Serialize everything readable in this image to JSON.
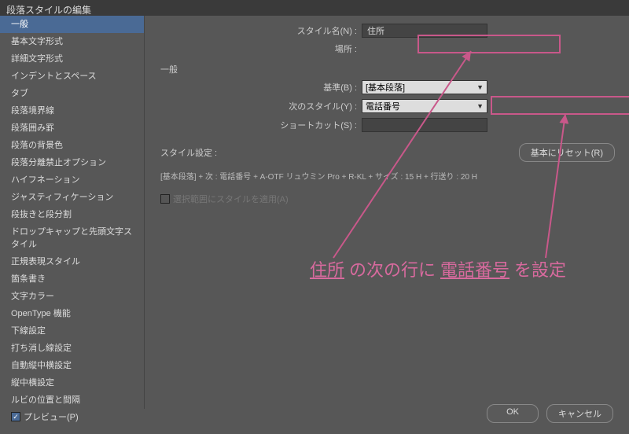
{
  "title": "段落スタイルの編集",
  "sidebar": {
    "items": [
      "一般",
      "基本文字形式",
      "詳細文字形式",
      "インデントとスペース",
      "タブ",
      "段落境界線",
      "段落囲み罫",
      "段落の背景色",
      "段落分離禁止オプション",
      "ハイフネーション",
      "ジャスティフィケーション",
      "段抜きと段分割",
      "ドロップキャップと先頭文字スタイル",
      "正規表現スタイル",
      "箇条書き",
      "文字カラー",
      "OpenType 機能",
      "下線設定",
      "打ち消し線設定",
      "自動縦中横設定",
      "縦中横設定",
      "ルビの位置と間隔"
    ],
    "selected": 0
  },
  "labels": {
    "styleName": "スタイル名(N) :",
    "location": "場所 :",
    "general": "一般",
    "base": "基準(B) :",
    "nextStyle": "次のスタイル(Y) :",
    "shortcut": "ショートカット(S) :",
    "styleSettings": "スタイル設定 :",
    "applyToSel": "選択範囲にスタイルを適用(A)",
    "preview": "プレビュー(P)"
  },
  "values": {
    "styleName": "住所",
    "location": "",
    "base": "[基本段落]",
    "nextStyle": "電話番号",
    "shortcut": ""
  },
  "buttons": {
    "reset": "基本にリセット(R)",
    "ok": "OK",
    "cancel": "キャンセル"
  },
  "summary": "[基本段落] + 次 : 電話番号 + A-OTF リュウミン Pro + R-KL + サイズ : 15 H + 行送り : 20 H",
  "annotation": {
    "part1": "住所",
    "part2": " の次の行に ",
    "part3": "電話番号",
    "part4": " を設定"
  }
}
